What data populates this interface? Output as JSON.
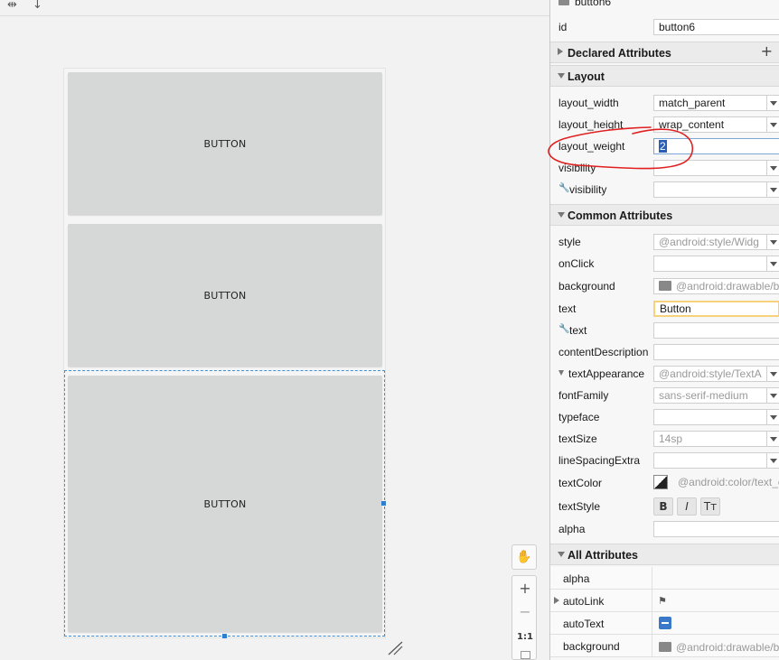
{
  "canvas": {
    "buttons": [
      "BUTTON",
      "BUTTON",
      "BUTTON"
    ],
    "zoom": {
      "fit_label": "1:1"
    }
  },
  "panel": {
    "component_name": "button6",
    "id_label": "id",
    "id_value": "button6",
    "sections": {
      "declared": "Declared Attributes",
      "layout": "Layout",
      "common": "Common Attributes",
      "all": "All Attributes"
    },
    "layout_rows": [
      {
        "label": "layout_width",
        "value": "match_parent"
      },
      {
        "label": "layout_height",
        "value": "wrap_content"
      },
      {
        "label": "layout_weight",
        "value": "2"
      },
      {
        "label": "visibility",
        "value": ""
      },
      {
        "label": "visibility",
        "value": ""
      }
    ],
    "common_rows": [
      {
        "label": "style",
        "value": "@android:style/Widg"
      },
      {
        "label": "onClick",
        "value": ""
      },
      {
        "label": "background",
        "value": "@android:drawable/b"
      },
      {
        "label": "text",
        "value": "Button"
      },
      {
        "label": "text",
        "value": ""
      },
      {
        "label": "contentDescription",
        "value": ""
      },
      {
        "label": "textAppearance",
        "value": "@android:style/TextA"
      },
      {
        "label": "fontFamily",
        "value": "sans-serif-medium"
      },
      {
        "label": "typeface",
        "value": ""
      },
      {
        "label": "textSize",
        "value": "14sp"
      },
      {
        "label": "lineSpacingExtra",
        "value": ""
      },
      {
        "label": "textColor",
        "value": "@android:color/text_c"
      },
      {
        "label": "textStyle",
        "value": ""
      },
      {
        "label": "alpha",
        "value": ""
      }
    ],
    "text_style_buttons": [
      "B",
      "I",
      "Tт"
    ],
    "all_rows": [
      {
        "label": "alpha",
        "value": ""
      },
      {
        "label": "autoLink",
        "value": ""
      },
      {
        "label": "autoText",
        "value": ""
      },
      {
        "label": "background",
        "value": "@android:drawable/b"
      }
    ]
  },
  "colors": {
    "selection": "#2f7fd0",
    "annotation": "#e02020",
    "focus": "#f6d27a"
  }
}
